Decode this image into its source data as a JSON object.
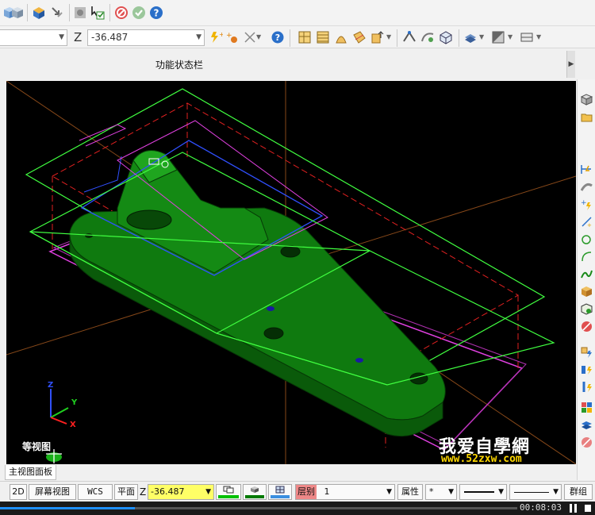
{
  "toolbar2": {
    "z_label": "Z",
    "z_value": "-36.487"
  },
  "function_bar": {
    "label": "功能状态栏"
  },
  "viewport": {
    "view_name": "等视图"
  },
  "tabs": {
    "main_panel": "主视图面板"
  },
  "statusbar": {
    "mode_2d": "2D",
    "screen_view": "屏幕视图",
    "wcs": "WCS",
    "plane": "平面",
    "z_label": "Z",
    "z_value": "-36.487",
    "layer_label": "层别",
    "layer_value": "1",
    "attr": "属性",
    "group": "群组",
    "line_color": "#00c000",
    "solid_color": "#007a00",
    "grid_color": "#3b8fe0",
    "z_highlight": "#ffff66"
  },
  "watermark": {
    "brand": "我爱自學網",
    "url": "www.52zxw.com"
  },
  "video": {
    "time": "00:08:03",
    "progress_fraction": 0.26
  }
}
